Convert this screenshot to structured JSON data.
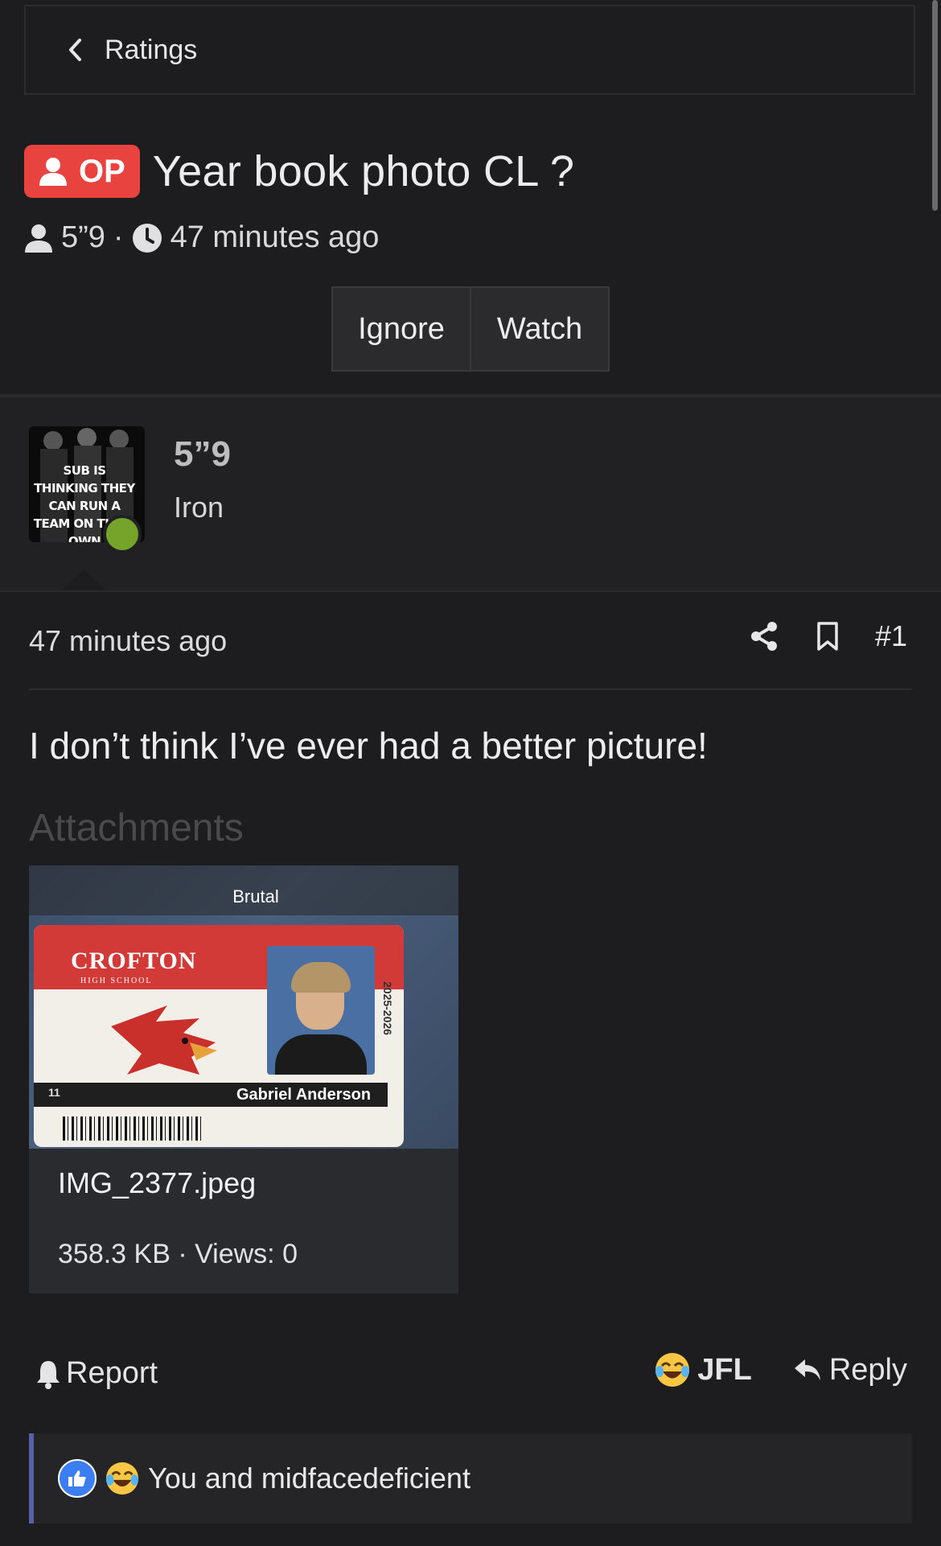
{
  "breadcrumb": {
    "label": "Ratings"
  },
  "thread": {
    "op_badge": "OP",
    "title": "Year book photo CL ?",
    "author": "5”9",
    "separator": "·",
    "time": "47 minutes ago"
  },
  "actions": {
    "ignore": "Ignore",
    "watch": "Watch"
  },
  "user": {
    "name": "5”9",
    "title": "Iron",
    "avatar_caption": "SUB IS THINKING THEY CAN RUN A TEAM ON THEIR OWN",
    "online": true
  },
  "post": {
    "time": "47 minutes ago",
    "number": "#1",
    "body": "I don’t think I’ve ever had a better picture!",
    "attachments_heading": "Attachments"
  },
  "attachment": {
    "caption_overlay": "Brutal",
    "school": "CROFTON",
    "school_sub": "HIGH SCHOOL",
    "year": "2025-2026",
    "grade": "11",
    "student_name": "Gabriel Anderson",
    "filename": "IMG_2377.jpeg",
    "meta": "358.3 KB · Views: 0"
  },
  "footer": {
    "report": "Report",
    "reaction": "JFL",
    "reply": "Reply"
  },
  "reactions": {
    "summary": "You and midfacedeficient"
  },
  "colors": {
    "background": "#1d1d1f",
    "op_badge": "#e8433e",
    "online": "#76a32a",
    "like": "#3b7ef2",
    "reaction_bar": "#5761a8"
  },
  "icons": [
    "chevron-left-icon",
    "user-icon",
    "clock-icon",
    "share-icon",
    "bookmark-icon",
    "bell-icon",
    "laughing-emoji-icon",
    "reply-icon",
    "thumbs-up-icon"
  ]
}
